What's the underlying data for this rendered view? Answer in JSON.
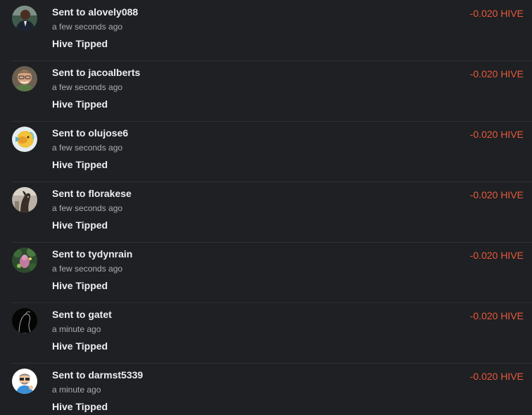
{
  "transactions": [
    {
      "prefix": "Sent to ",
      "username": "alovely088",
      "time": "a few seconds ago",
      "type": "Hive Tipped",
      "amount": "-0.020 HIVE",
      "avatar_icon": "user-avatar-man-dark-suit"
    },
    {
      "prefix": "Sent to ",
      "username": "jacoalberts",
      "time": "a few seconds ago",
      "type": "Hive Tipped",
      "amount": "-0.020 HIVE",
      "avatar_icon": "user-avatar-man-glasses"
    },
    {
      "prefix": "Sent to ",
      "username": "olujose6",
      "time": "a few seconds ago",
      "type": "Hive Tipped",
      "amount": "-0.020 HIVE",
      "avatar_icon": "user-avatar-yellow-fish"
    },
    {
      "prefix": "Sent to ",
      "username": "florakese",
      "time": "a few seconds ago",
      "type": "Hive Tipped",
      "amount": "-0.020 HIVE",
      "avatar_icon": "user-avatar-horse"
    },
    {
      "prefix": "Sent to ",
      "username": "tydynrain",
      "time": "a few seconds ago",
      "type": "Hive Tipped",
      "amount": "-0.020 HIVE",
      "avatar_icon": "user-avatar-flower-garden"
    },
    {
      "prefix": "Sent to ",
      "username": "gatet",
      "time": "a minute ago",
      "type": "Hive Tipped",
      "amount": "-0.020 HIVE",
      "avatar_icon": "user-avatar-dark-silhouette"
    },
    {
      "prefix": "Sent to ",
      "username": "darmst5339",
      "time": "a minute ago",
      "type": "Hive Tipped",
      "amount": "-0.020 HIVE",
      "avatar_icon": "user-avatar-cartoon-man"
    }
  ],
  "colors": {
    "background": "#1e2023",
    "divider": "#2e3135",
    "primary_text": "#eceef0",
    "secondary_text": "#a9adb3",
    "amount_negative": "#e8593b"
  }
}
